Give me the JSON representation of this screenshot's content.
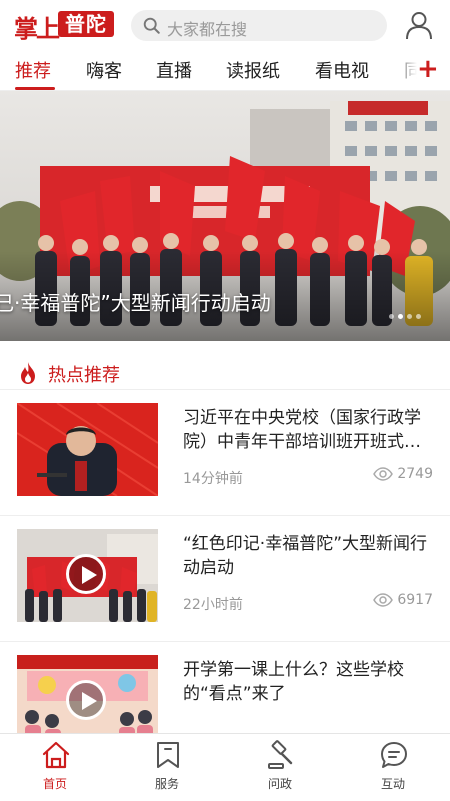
{
  "header": {
    "logo_text_a": "掌上",
    "logo_text_b": "普陀",
    "search_placeholder": "大家都在搜"
  },
  "tabs": [
    {
      "label": "推荐",
      "active": true
    },
    {
      "label": "嗨客",
      "active": false
    },
    {
      "label": "直播",
      "active": false
    },
    {
      "label": "读报纸",
      "active": false
    },
    {
      "label": "看电视",
      "active": false
    },
    {
      "label": "同",
      "active": false
    }
  ],
  "banner": {
    "caption": "己·幸福普陀”大型新闻行动启动",
    "slide_count": 4,
    "active_slide": 2
  },
  "section": {
    "title": "热点推荐"
  },
  "news": [
    {
      "title": "习近平在中央党校（国家行政学院）中青年干部培训班开班式…",
      "time": "14分钟前",
      "views": "2749",
      "video": false
    },
    {
      "title": "“红色印记·幸福普陀”大型新闻行动启动",
      "time": "22小时前",
      "views": "6917",
      "video": true
    },
    {
      "title": "开学第一课上什么？这些学校的“看点”来了",
      "time": "",
      "views": "",
      "video": true
    }
  ],
  "bottom_nav": [
    {
      "label": "首页",
      "icon": "home-icon",
      "active": true
    },
    {
      "label": "服务",
      "icon": "bookmark-icon",
      "active": false
    },
    {
      "label": "问政",
      "icon": "gavel-icon",
      "active": false
    },
    {
      "label": "互动",
      "icon": "chat-icon",
      "active": false
    }
  ],
  "colors": {
    "brand_red": "#cc1d1d",
    "muted_gray": "#999999"
  }
}
